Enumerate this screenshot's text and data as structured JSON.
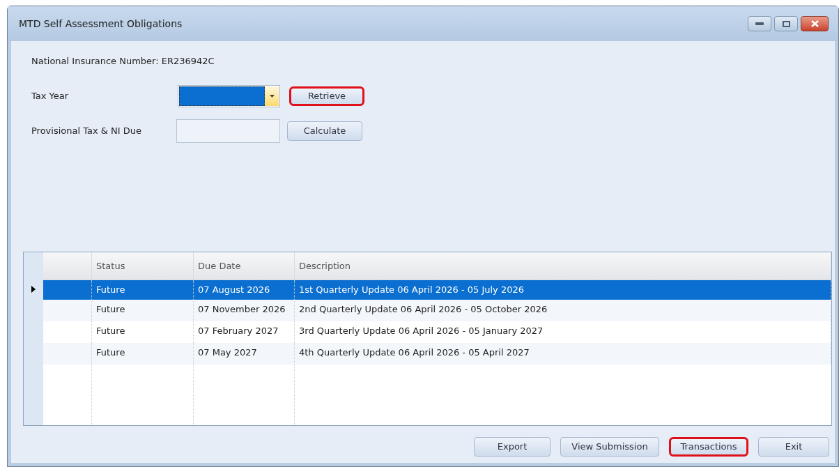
{
  "window": {
    "title": "MTD Self Assessment Obligations"
  },
  "ni_number": "National Insurance Number: ER236942C",
  "tax_year": {
    "label": "Tax Year"
  },
  "retrieve_button": {
    "label": "Retrieve",
    "highlighted": true
  },
  "provisional": {
    "label": "Provisional Tax & NI Due"
  },
  "calculate_button": {
    "label": "Calculate",
    "highlighted": false
  },
  "table": {
    "columns": [
      "Status",
      "Due Date",
      "Description"
    ],
    "rows": [
      {
        "status": "Future",
        "due_date": "07 August 2026",
        "description": "1st Quarterly Update 06 April 2026 - 05 July 2026",
        "selected": true
      },
      {
        "status": "Future",
        "due_date": "07 November 2026",
        "description": "2nd Quarterly Update 06 April 2026 - 05 October 2026",
        "selected": false
      },
      {
        "status": "Future",
        "due_date": "07 February 2027",
        "description": "3rd Quarterly Update 06 April 2026 - 05 January 2027",
        "selected": false
      },
      {
        "status": "Future",
        "due_date": "07 May 2027",
        "description": "4th Quarterly Update 06 April 2026 - 05 April 2027",
        "selected": false
      }
    ]
  },
  "buttons": [
    {
      "label": "Export",
      "highlighted": false
    },
    {
      "label": "View Submission",
      "highlighted": false
    },
    {
      "label": "Transactions",
      "highlighted": true
    },
    {
      "label": "Exit",
      "highlighted": false
    }
  ]
}
